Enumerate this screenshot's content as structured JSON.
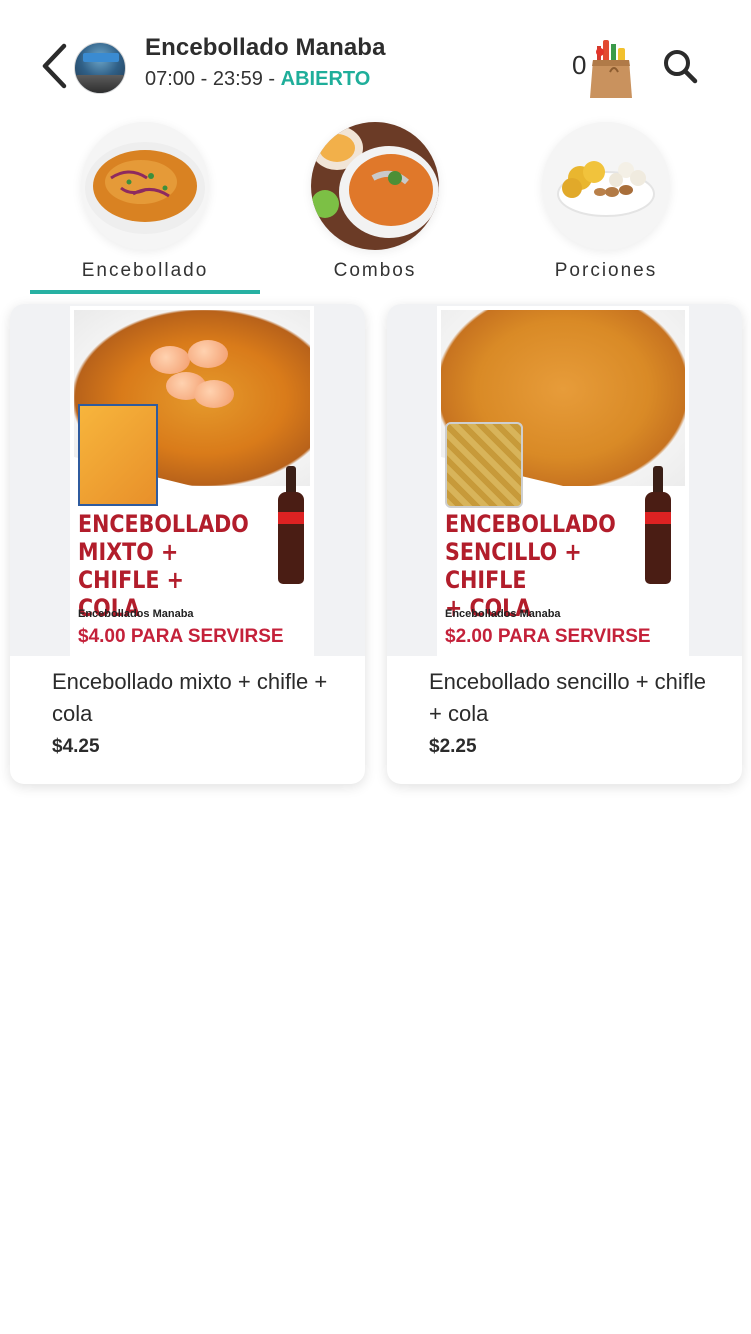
{
  "header": {
    "store_name": "Encebollado Manaba",
    "hours": "07:00 - 23:59 - ",
    "status": "ABIERTO",
    "cart_count": "0"
  },
  "tabs": [
    {
      "label": "Encebollado",
      "active": true
    },
    {
      "label": "Combos",
      "active": false
    },
    {
      "label": "Porciones",
      "active": false
    }
  ],
  "products": [
    {
      "name": "Encebollado mixto + chifle + cola",
      "price": "$4.25",
      "poster": {
        "headline": "ENCEBOLLADO\nMIXTO + CHIFLE +\nCOLA",
        "brand": "Encebollados Manaba",
        "price_text": "$4.00 PARA SERVIRSE"
      }
    },
    {
      "name": "Encebollado sencillo + chifle + cola",
      "price": "$2.25",
      "poster": {
        "headline": "ENCEBOLLADO\nSENCILLO + CHIFLE\n+ COLA",
        "brand": "Encebollados Manaba",
        "price_text": "$2.00 PARA SERVIRSE"
      }
    }
  ],
  "colors": {
    "accent": "#26b0a2",
    "status_open": "#1fae9a",
    "poster_red": "#b21d2b"
  },
  "icons": {
    "back": "chevron-left-icon",
    "cart": "grocery-bag-icon",
    "search": "search-icon"
  }
}
